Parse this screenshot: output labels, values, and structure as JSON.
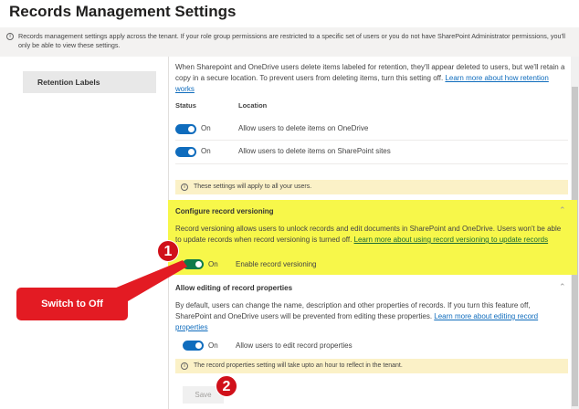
{
  "page_title": "Records Management Settings",
  "info_banner": "Records management settings apply across the tenant. If your role group permissions are restricted to a specific set of users or you do not have SharePoint Administrator permissions, you'll only be able to view these settings.",
  "sidebar": {
    "items": [
      {
        "label": "Retention Labels"
      }
    ]
  },
  "deletion": {
    "description": "When Sharepoint and OneDrive users delete items labeled for retention, they'll appear deleted to users, but we'll retain a copy in a secure location. To prevent users from deleting items, turn this setting off.",
    "link": "Learn more about how retention works",
    "col_status": "Status",
    "col_location": "Location",
    "rows": [
      {
        "state": "On",
        "label": "Allow users to delete items on OneDrive",
        "on": true
      },
      {
        "state": "On",
        "label": "Allow users to delete items on SharePoint sites",
        "on": true
      }
    ],
    "notice": "These settings will apply to all your users."
  },
  "versioning": {
    "title": "Configure record versioning",
    "description": "Record versioning allows users to unlock records and edit documents in SharePoint and OneDrive. Users won't be able to update records when record versioning is turned off.",
    "link": "Learn more about using record versioning to update records",
    "toggle_state": "On",
    "toggle_label": "Enable record versioning",
    "on": true,
    "highlight_color": "#f7f74a"
  },
  "editing": {
    "title": "Allow editing of record properties",
    "description": "By default, users can change the name, description and other properties of records. If you turn this feature off, SharePoint and OneDrive users will be prevented from editing these properties.",
    "link": "Learn more about editing record properties",
    "toggle_state": "On",
    "toggle_label": "Allow users to edit record properties",
    "on": true,
    "notice": "The record properties setting will take upto an hour to reflect in the tenant."
  },
  "save_label": "Save",
  "annotations": {
    "callout": "Switch to Off",
    "step1": "1",
    "step2": "2",
    "color": "#e31b23"
  }
}
